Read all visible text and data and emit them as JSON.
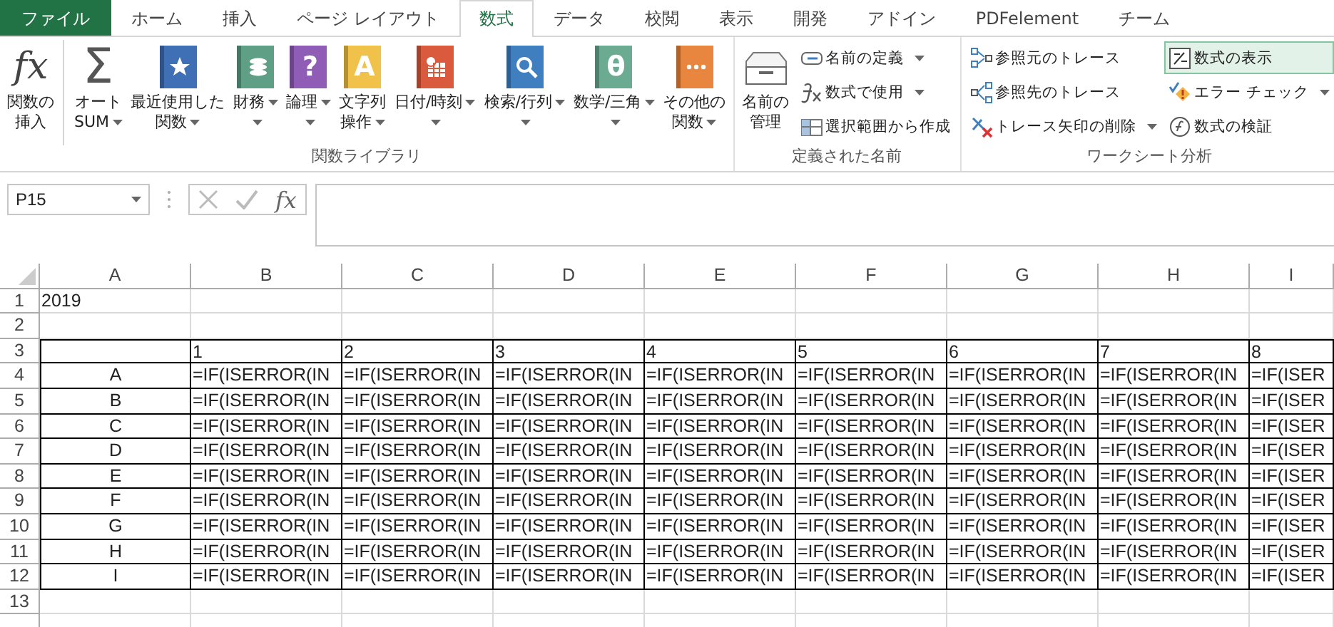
{
  "tabs": [
    {
      "label": "ファイル",
      "kind": "file",
      "selected": false
    },
    {
      "label": "ホーム",
      "kind": "tab",
      "selected": false
    },
    {
      "label": "挿入",
      "kind": "tab",
      "selected": false
    },
    {
      "label": "ページ レイアウト",
      "kind": "tab",
      "selected": false
    },
    {
      "label": "数式",
      "kind": "tab",
      "selected": true
    },
    {
      "label": "データ",
      "kind": "tab",
      "selected": false
    },
    {
      "label": "校閲",
      "kind": "tab",
      "selected": false
    },
    {
      "label": "表示",
      "kind": "tab",
      "selected": false
    },
    {
      "label": "開発",
      "kind": "tab",
      "selected": false
    },
    {
      "label": "アドイン",
      "kind": "tab",
      "selected": false
    },
    {
      "label": "PDFelement",
      "kind": "tab",
      "selected": false
    },
    {
      "label": "チーム",
      "kind": "tab",
      "selected": false
    }
  ],
  "ribbon": {
    "groups": [
      {
        "title": "関数ライブラリ",
        "large": [
          {
            "label": [
              "関数の",
              "挿入"
            ],
            "icon": {
              "kind": "glyph",
              "text": "fx"
            },
            "dropdown": false,
            "separator_after": true
          },
          {
            "label": [
              "オート",
              "SUM"
            ],
            "icon": {
              "kind": "sigma",
              "text": "Σ"
            },
            "dropdown": true,
            "separator_after": false
          },
          {
            "label": [
              "最近使用した",
              "関数"
            ],
            "icon": {
              "kind": "book-star",
              "color": "#3f6fb5"
            },
            "dropdown": true,
            "separator_after": false
          },
          {
            "label": [
              "財務"
            ],
            "icon": {
              "kind": "book-coins",
              "color": "#5e9f86"
            },
            "dropdown": true,
            "separator_after": false
          },
          {
            "label": [
              "論理"
            ],
            "icon": {
              "kind": "book-text",
              "color": "#8f5cb6",
              "text": "?"
            },
            "dropdown": true,
            "separator_after": false
          },
          {
            "label": [
              "文字列",
              "操作"
            ],
            "icon": {
              "kind": "book-text",
              "color": "#f0c24a",
              "text": "A"
            },
            "dropdown": true,
            "separator_after": false
          },
          {
            "label": [
              "日付/時刻"
            ],
            "icon": {
              "kind": "book-calendar",
              "color": "#d95a3c"
            },
            "dropdown": true,
            "separator_after": false
          },
          {
            "label": [
              "検索/行列"
            ],
            "icon": {
              "kind": "book-search",
              "color": "#3f7fc0"
            },
            "dropdown": true,
            "separator_after": false
          },
          {
            "label": [
              "数学/三角"
            ],
            "icon": {
              "kind": "book-text",
              "color": "#6aab92",
              "text": "θ"
            },
            "dropdown": true,
            "separator_after": false
          },
          {
            "label": [
              "その他の",
              "関数"
            ],
            "icon": {
              "kind": "book-dots",
              "color": "#e8853f"
            },
            "dropdown": true,
            "separator_after": false
          }
        ]
      },
      {
        "title": "定義された名前",
        "large": [
          {
            "label": [
              "名前の",
              "管理"
            ],
            "icon": {
              "kind": "drawer"
            },
            "dropdown": false,
            "separator_after": false
          }
        ],
        "columns": [
          [
            {
              "label": "名前の定義",
              "kind": "tag",
              "dropdown": true,
              "selected": false
            },
            {
              "label": "数式で使用",
              "kind": "formula",
              "dropdown": true,
              "selected": false
            },
            {
              "label": "選択範囲から作成",
              "kind": "grid",
              "dropdown": false,
              "selected": false
            }
          ]
        ]
      },
      {
        "title": "ワークシート分析",
        "columns": [
          [
            {
              "label": "参照元のトレース",
              "kind": "precedents",
              "dropdown": false,
              "selected": false
            },
            {
              "label": "参照先のトレース",
              "kind": "dependents",
              "dropdown": false,
              "selected": false
            },
            {
              "label": "トレース矢印の削除",
              "kind": "remove",
              "dropdown": true,
              "selected": false
            }
          ],
          [
            {
              "label": "数式の表示",
              "kind": "show",
              "dropdown": false,
              "selected": true
            },
            {
              "label": "エラー チェック",
              "kind": "check",
              "dropdown": true,
              "selected": false
            },
            {
              "label": "数式の検証",
              "kind": "evaluate",
              "dropdown": false,
              "selected": false
            }
          ]
        ]
      }
    ]
  },
  "formula_bar": {
    "name_box": "P15",
    "fx": "fx"
  },
  "sheet": {
    "columns": [
      "A",
      "B",
      "C",
      "D",
      "E",
      "F",
      "G",
      "H",
      "I"
    ],
    "rows": [
      {
        "number": "1",
        "kind": "title",
        "label": "2019"
      },
      {
        "number": "2",
        "kind": "empty"
      },
      {
        "number": "3",
        "kind": "header",
        "values": [
          "1",
          "2",
          "3",
          "4",
          "5",
          "6",
          "7",
          "8"
        ]
      },
      {
        "number": "4",
        "kind": "data",
        "label": "A",
        "values": [
          "=IF(ISERROR(IN",
          "=IF(ISERROR(IN",
          "=IF(ISERROR(IN",
          "=IF(ISERROR(IN",
          "=IF(ISERROR(IN",
          "=IF(ISERROR(IN",
          "=IF(ISERROR(IN",
          "=IF(ISER"
        ]
      },
      {
        "number": "5",
        "kind": "data",
        "label": "B",
        "values": [
          "=IF(ISERROR(IN",
          "=IF(ISERROR(IN",
          "=IF(ISERROR(IN",
          "=IF(ISERROR(IN",
          "=IF(ISERROR(IN",
          "=IF(ISERROR(IN",
          "=IF(ISERROR(IN",
          "=IF(ISER"
        ]
      },
      {
        "number": "6",
        "kind": "data",
        "label": "C",
        "values": [
          "=IF(ISERROR(IN",
          "=IF(ISERROR(IN",
          "=IF(ISERROR(IN",
          "=IF(ISERROR(IN",
          "=IF(ISERROR(IN",
          "=IF(ISERROR(IN",
          "=IF(ISERROR(IN",
          "=IF(ISER"
        ]
      },
      {
        "number": "7",
        "kind": "data",
        "label": "D",
        "values": [
          "=IF(ISERROR(IN",
          "=IF(ISERROR(IN",
          "=IF(ISERROR(IN",
          "=IF(ISERROR(IN",
          "=IF(ISERROR(IN",
          "=IF(ISERROR(IN",
          "=IF(ISERROR(IN",
          "=IF(ISER"
        ]
      },
      {
        "number": "8",
        "kind": "data",
        "label": "E",
        "values": [
          "=IF(ISERROR(IN",
          "=IF(ISERROR(IN",
          "=IF(ISERROR(IN",
          "=IF(ISERROR(IN",
          "=IF(ISERROR(IN",
          "=IF(ISERROR(IN",
          "=IF(ISERROR(IN",
          "=IF(ISER"
        ]
      },
      {
        "number": "9",
        "kind": "data",
        "label": "F",
        "values": [
          "=IF(ISERROR(IN",
          "=IF(ISERROR(IN",
          "=IF(ISERROR(IN",
          "=IF(ISERROR(IN",
          "=IF(ISERROR(IN",
          "=IF(ISERROR(IN",
          "=IF(ISERROR(IN",
          "=IF(ISER"
        ]
      },
      {
        "number": "10",
        "kind": "data",
        "label": "G",
        "values": [
          "=IF(ISERROR(IN",
          "=IF(ISERROR(IN",
          "=IF(ISERROR(IN",
          "=IF(ISERROR(IN",
          "=IF(ISERROR(IN",
          "=IF(ISERROR(IN",
          "=IF(ISERROR(IN",
          "=IF(ISER"
        ]
      },
      {
        "number": "11",
        "kind": "data",
        "label": "H",
        "values": [
          "=IF(ISERROR(IN",
          "=IF(ISERROR(IN",
          "=IF(ISERROR(IN",
          "=IF(ISERROR(IN",
          "=IF(ISERROR(IN",
          "=IF(ISERROR(IN",
          "=IF(ISERROR(IN",
          "=IF(ISER"
        ]
      },
      {
        "number": "12",
        "kind": "data",
        "label": "I",
        "values": [
          "=IF(ISERROR(IN",
          "=IF(ISERROR(IN",
          "=IF(ISERROR(IN",
          "=IF(ISERROR(IN",
          "=IF(ISERROR(IN",
          "=IF(ISERROR(IN",
          "=IF(ISERROR(IN",
          "=IF(ISER"
        ]
      },
      {
        "number": "13",
        "kind": "empty"
      }
    ]
  }
}
